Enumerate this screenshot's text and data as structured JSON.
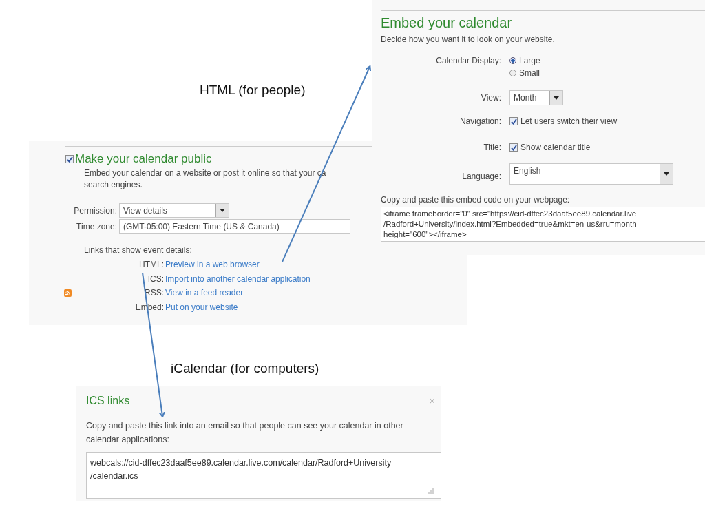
{
  "embed_panel": {
    "title": "Embed your calendar",
    "subtitle": "Decide how you want it to look on your website.",
    "display_label": "Calendar Display:",
    "display_options": [
      {
        "label": "Large",
        "selected": true
      },
      {
        "label": "Small",
        "selected": false
      }
    ],
    "view_label": "View:",
    "view_value": "Month",
    "navigation_label": "Navigation:",
    "navigation": {
      "label": "Let users switch their view",
      "checked": true
    },
    "title_label": "Title:",
    "title_option": {
      "label": "Show calendar title",
      "checked": true
    },
    "language_label": "Language:",
    "language_value": "English",
    "code_label": "Copy and paste this embed code on your webpage:",
    "code_lines": [
      "<iframe frameborder=\"0\" src=\"https://cid-dffec23daaf5ee89.calendar.live",
      "/Radford+University/index.html?Embedded=true&mkt=en-us&rru=month",
      "height=\"600\"></iframe>"
    ]
  },
  "annotations": [
    {
      "text": "HTML (for people)"
    },
    {
      "text": "iCalendar (for computers)"
    }
  ],
  "public_panel": {
    "checked": true,
    "title": "Make your calendar public",
    "description_lines": [
      "Embed your calendar on a website or post it online so that your ca",
      "search engines."
    ],
    "permission_label": "Permission:",
    "permission_value": "View details",
    "timezone_label": "Time zone:",
    "timezone_value": "(GMT-05:00) Eastern Time (US & Canada)",
    "links_heading": "Links that show event details:",
    "links": [
      {
        "kind": "plain",
        "label": "HTML:",
        "text": "Preview in a web browser"
      },
      {
        "kind": "plain",
        "label": "ICS:",
        "text": "Import into another calendar application"
      },
      {
        "kind": "feed",
        "label": "RSS:",
        "text": "View in a feed reader"
      },
      {
        "kind": "plain",
        "label": "Embed:",
        "text": "Put on your website"
      }
    ]
  },
  "ics_panel": {
    "title": "ICS links",
    "close": "×",
    "description": "Copy and paste this link into an email so that people can see your calendar in other calendar applications:",
    "link_lines": [
      "webcals://cid-dffec23daaf5ee89.calendar.live.com/calendar/Radford+University",
      "/calendar.ics"
    ]
  }
}
